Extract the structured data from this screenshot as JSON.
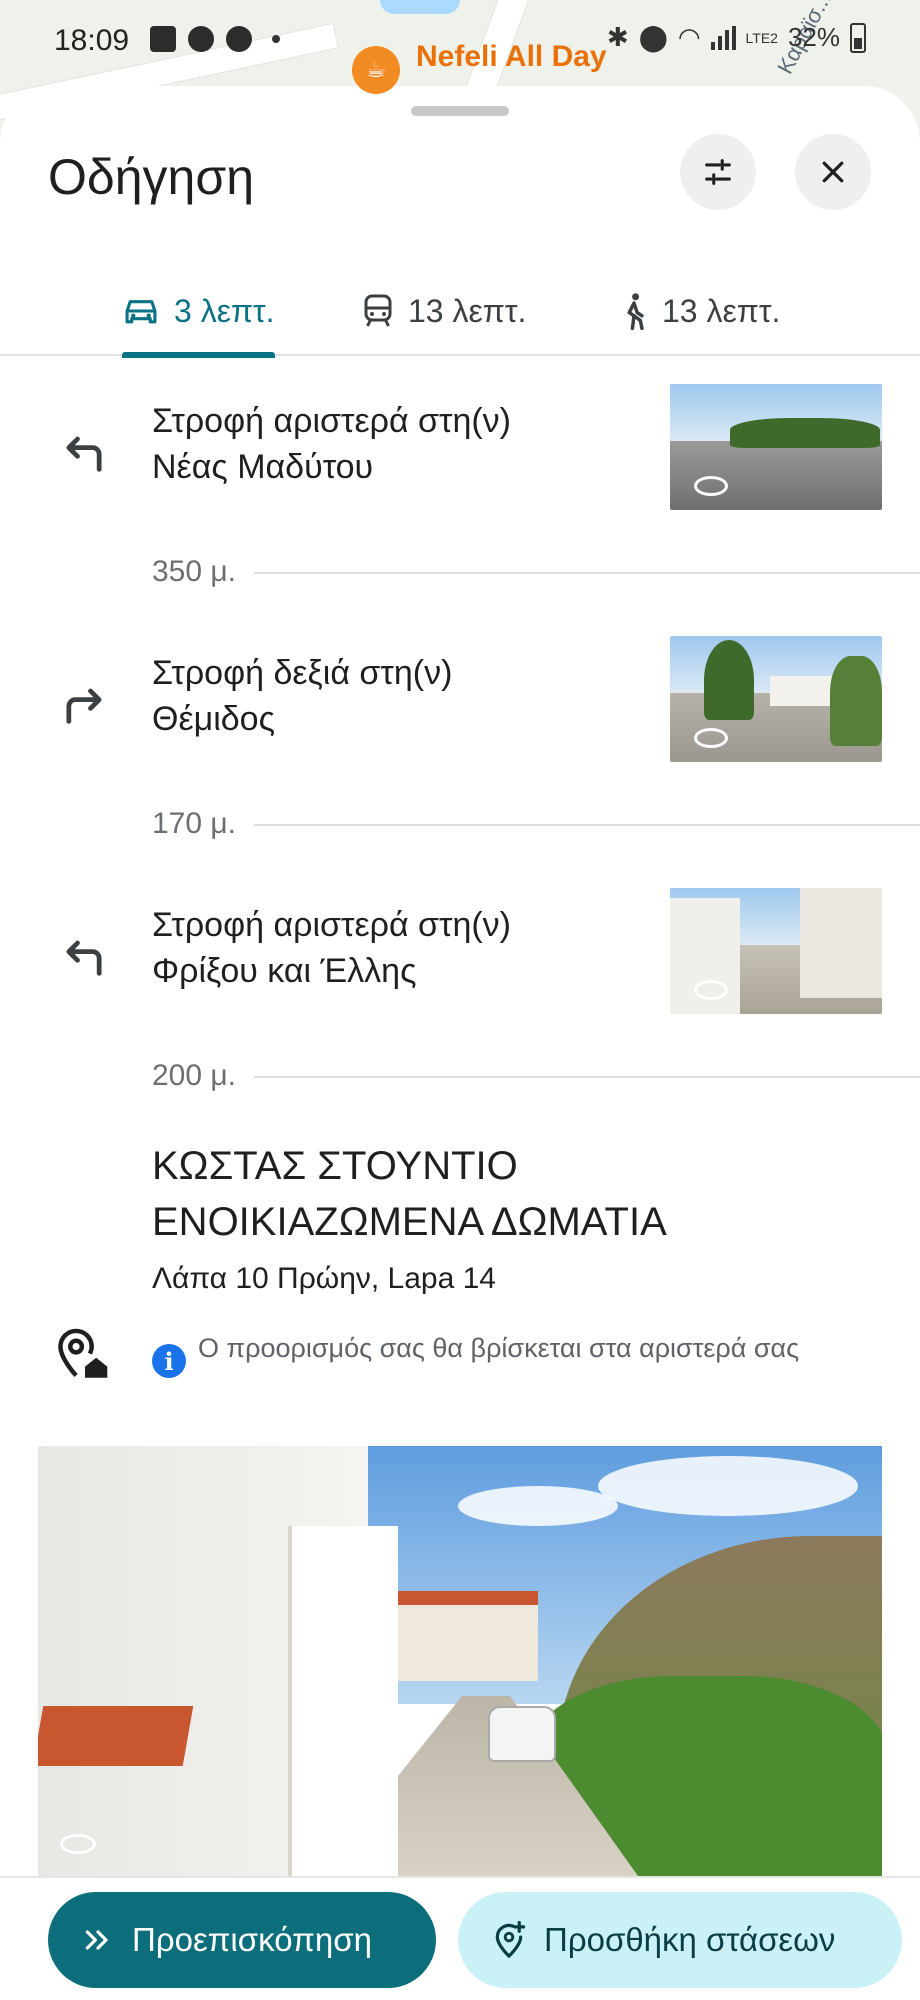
{
  "status_bar": {
    "time": "18:09",
    "battery": "32%",
    "network": "LTE2",
    "left_icons": [
      "gallery-icon",
      "incognito-icon",
      "chrome-icon"
    ],
    "right_icons": [
      "bluetooth-icon",
      "location-icon",
      "wifi-icon",
      "signal-icon",
      "battery-icon"
    ]
  },
  "map": {
    "place_label": "Nefeli All Day",
    "street_label": "Καραϊσ..."
  },
  "sheet": {
    "title": "Οδήγηση",
    "filter_icon": "tune-icon",
    "close_icon": "close-icon"
  },
  "tabs": [
    {
      "icon": "car-icon",
      "label": "3 λεπτ.",
      "active": true
    },
    {
      "icon": "transit-icon",
      "label": "13 λεπτ.",
      "active": false
    },
    {
      "icon": "walk-icon",
      "label": "13 λεπτ.",
      "active": false
    }
  ],
  "steps": [
    {
      "icon": "turn-left-icon",
      "line1": "Στροφή αριστερά στη(ν)",
      "line2": "Νέας Μαδύτου",
      "distance": "350 μ."
    },
    {
      "icon": "turn-right-icon",
      "line1": "Στροφή δεξιά στη(ν)",
      "line2": "Θέμιδος",
      "distance": "170 μ."
    },
    {
      "icon": "turn-left-icon",
      "line1": "Στροφή αριστερά στη(ν)",
      "line2": "Φρίξου και Έλλης",
      "distance": "200 μ."
    }
  ],
  "destination": {
    "icon": "destination-pin-icon",
    "name_line1": "ΚΩΣΤΑΣ ΣΤΟΥΝΤΙΟ",
    "name_line2": "ΕΝΟΙΚΙΑΖΩΜΕΝΑ ΔΩΜΑΤΙΑ",
    "address": "Λάπα 10 Πρώην, Lapa 14",
    "note": "Ο προορισμός σας θα βρίσκεται στα αριστερά σας"
  },
  "actions": {
    "preview_label": "Προεπισκόπηση",
    "preview_icon": "double-chevron-icon",
    "add_stops_label": "Προσθήκη στάσεων",
    "add_stops_icon": "add-location-icon"
  },
  "colors": {
    "accent": "#0b7285",
    "primary_button": "#0b6e7a",
    "secondary_button": "#c9f1f6",
    "info": "#1a73e8",
    "map_label": "#e8710a"
  }
}
